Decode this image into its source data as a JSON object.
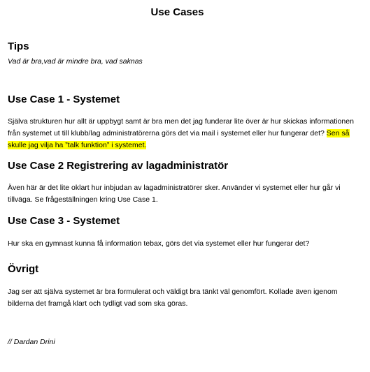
{
  "document": {
    "title": "Use Cases",
    "tips": {
      "heading": "Tips",
      "text": "Vad är bra,vad är mindre bra, vad saknas"
    },
    "use_case_1": {
      "heading": "Use Case 1 - Systemet",
      "text": "Själva strukturen hur allt är uppbygt samt är bra men det jag funderar lite över är hur skickas informationen från systemet ut till klubb/lag administratörerna görs det via mail i systemet eller hur fungerar det? ",
      "highlighted_text": "Sen så skulle jag vilja ha ”talk funktion” i systemet.",
      "highlight_color": "#ffff00"
    },
    "use_case_2": {
      "heading": "Use Case 2 Registrering av lagadministratör",
      "text": "Även här är det lite oklart hur inbjudan av lagadministratörer sker. Använder vi systemet eller hur går vi tillväga. Se frågeställningen kring Use Case 1."
    },
    "use_case_3": {
      "heading": "Use Case 3 - Systemet",
      "text": "Hur ska en gymnast kunna få information tebax, görs det via systemet eller hur fungerar det?"
    },
    "other": {
      "heading": "Övrigt",
      "text": "Jag ser att själva systemet är bra formulerat och väldigt bra tänkt väl genomfört. Kollade även igenom bilderna det framgå klart och tydligt vad som ska göras."
    },
    "signature": "// Dardan Drini"
  }
}
